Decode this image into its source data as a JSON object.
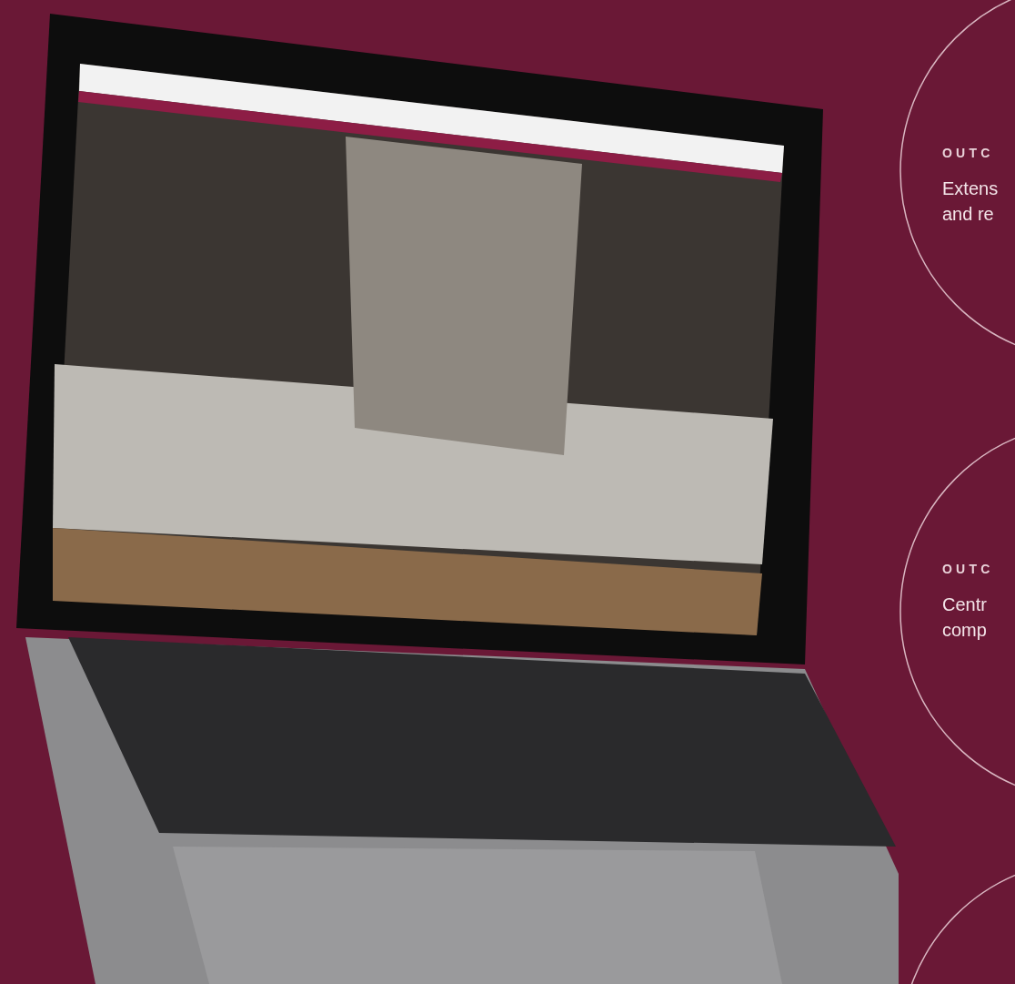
{
  "outcomes": [
    {
      "label": "OUTC",
      "lines": [
        "Extens",
        "and re"
      ]
    },
    {
      "label": "OUTC",
      "lines": [
        "Centr",
        "comp"
      ]
    }
  ]
}
